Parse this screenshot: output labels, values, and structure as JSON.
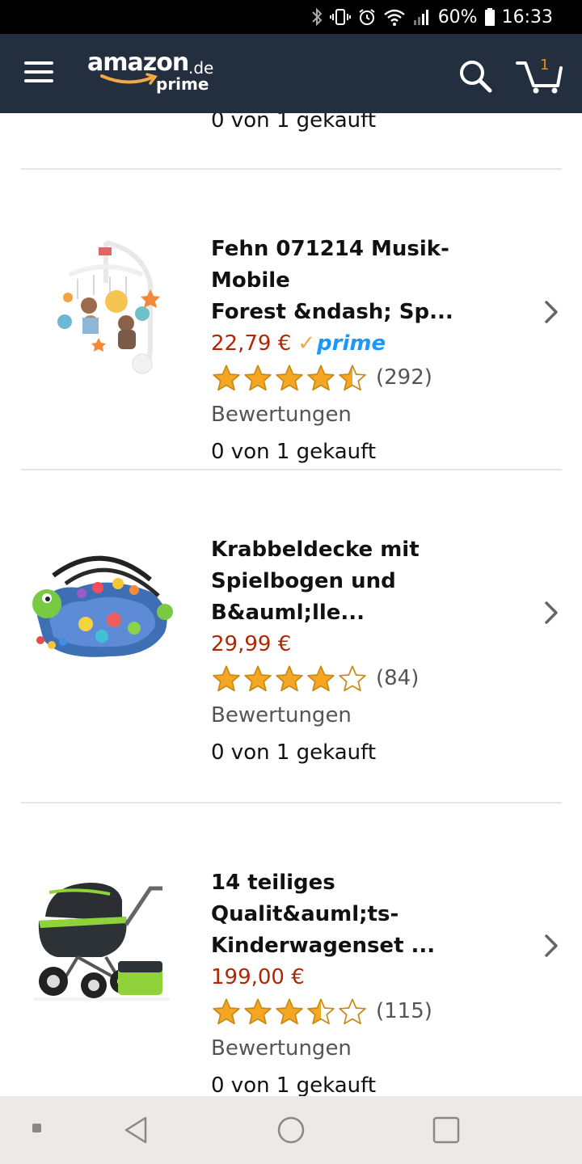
{
  "status_bar": {
    "battery": "60%",
    "time": "16:33"
  },
  "header": {
    "logo_brand": "amazon",
    "logo_tld": ".de",
    "logo_sub": "prime",
    "cart_count": "1",
    "colors": {
      "background": "#232f3e",
      "accent": "#f3a847",
      "cart_count": "#f08804"
    }
  },
  "partial_item": {
    "bought": "0 von 1 gekauft"
  },
  "products": [
    {
      "title_line1": "Fehn 071214 Musik-Mobile",
      "title_line2": "Forest &ndash; Sp...",
      "price": "22,79 €",
      "prime": true,
      "prime_check": "✓",
      "prime_label": "prime",
      "rating": 4.5,
      "review_count": "(292)",
      "reviews_label": "Bewertungen",
      "bought": "0 von 1 gekauft",
      "image_icon": "baby-mobile"
    },
    {
      "title_line1": "Krabbeldecke mit",
      "title_line2": "Spielbogen und",
      "title_line3": "B&auml;lle...",
      "price": "29,99 €",
      "prime": false,
      "rating": 4,
      "review_count": "(84)",
      "reviews_label": "Bewertungen",
      "bought": "0 von 1 gekauft",
      "image_icon": "play-mat"
    },
    {
      "title_line1": "14 teiliges Qualit&auml;ts-",
      "title_line2": "Kinderwagenset ...",
      "price": "199,00 €",
      "prime": false,
      "rating": 3.5,
      "review_count": "(115)",
      "reviews_label": "Bewertungen",
      "bought": "0 von 1 gekauft",
      "image_icon": "stroller"
    }
  ],
  "colors": {
    "price": "#b12704",
    "star": "#f5a623",
    "prime_blue": "#1a98ff",
    "divider": "#e3e6e6",
    "nav_bar": "#eceae6"
  },
  "nav_bar": {
    "icons": [
      "dot-icon",
      "back-icon",
      "home-icon",
      "recents-icon"
    ]
  }
}
